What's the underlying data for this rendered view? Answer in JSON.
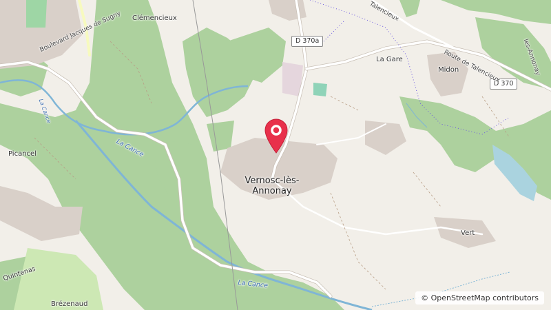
{
  "places": {
    "town": "Vernosc-lès-Annonay",
    "clemencieux": "Clémencieux",
    "la_gare": "La Gare",
    "midon": "Midon",
    "picancel": "Picancel",
    "brezenaud": "Brézenaud",
    "vert": "Vert",
    "quintenas": "Quintenas"
  },
  "roads": {
    "d370a": "D 370a",
    "d370": "D 370",
    "boulevard": "Boulevard Jacques de Sugny",
    "route_talencieux": "Route de Talencieux",
    "talencieux_top": "Talencieux",
    "annonay_right": "les-Annonay"
  },
  "rivers": {
    "cance1": "La Cance",
    "cance2": "La Cance",
    "cance_left": "La Cance"
  },
  "attribution": {
    "symbol": "©",
    "text": "OpenStreetMap contributors"
  },
  "marker": {
    "icon": "map-pin-icon",
    "color": "#e8304b"
  },
  "colors": {
    "forest": "#add19e",
    "water": "#aad3df",
    "river_line": "#7fb5d6",
    "land": "#f2efe9",
    "urban": "#d9d0c9"
  }
}
